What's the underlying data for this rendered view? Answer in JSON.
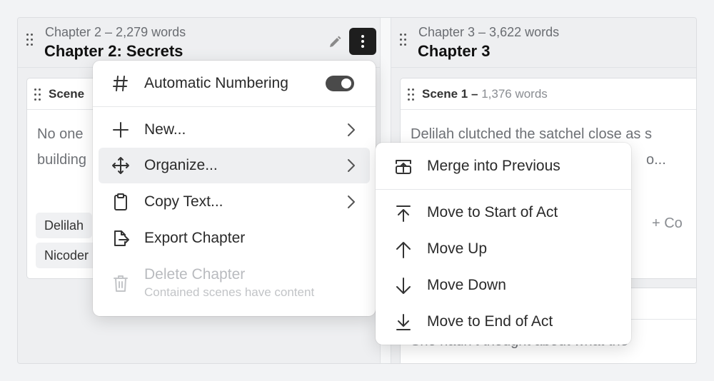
{
  "chapters": [
    {
      "meta": "Chapter 2 – 2,279 words",
      "title": "Chapter 2: Secrets",
      "scene": {
        "title": "Scene",
        "body_lines": [
          "No one",
          "building"
        ],
        "tags": [
          "Delilah",
          "Nicoder"
        ]
      }
    },
    {
      "meta": "Chapter 3 – 3,622 words",
      "title": "Chapter 3",
      "scene": {
        "title": "Scene 1 –",
        "word_count": "1,376 words",
        "body_lines": [
          "Delilah clutched the satchel close as s",
          "o..."
        ],
        "add_label": "+ Co"
      },
      "scene2_body": "She hadn’t thought about what the"
    }
  ],
  "chapter_menu": {
    "items": [
      {
        "label": "Automatic Numbering",
        "icon": "hash-icon",
        "toggle_on": true
      },
      {
        "label": "New...",
        "icon": "plus-icon"
      },
      {
        "label": "Organize...",
        "icon": "move-icon",
        "highlighted": true
      },
      {
        "label": "Copy Text...",
        "icon": "clipboard-icon"
      },
      {
        "label": "Export Chapter",
        "icon": "export-icon"
      },
      {
        "label": "Delete Chapter",
        "icon": "trash-icon",
        "disabled": true,
        "sublabel": "Contained scenes have content"
      }
    ]
  },
  "organize_submenu": {
    "items": [
      {
        "label": "Merge into Previous",
        "icon": "merge-icon"
      },
      {
        "label": "Move to Start of Act",
        "icon": "arrow-to-top-icon"
      },
      {
        "label": "Move Up",
        "icon": "arrow-up-icon"
      },
      {
        "label": "Move Down",
        "icon": "arrow-down-icon"
      },
      {
        "label": "Move to End of Act",
        "icon": "arrow-to-bottom-icon"
      }
    ]
  },
  "colors": {
    "accent_dark": "#1e1e1e",
    "menu_hover": "#eeeff1",
    "disabled_text": "#b9bbbf"
  }
}
